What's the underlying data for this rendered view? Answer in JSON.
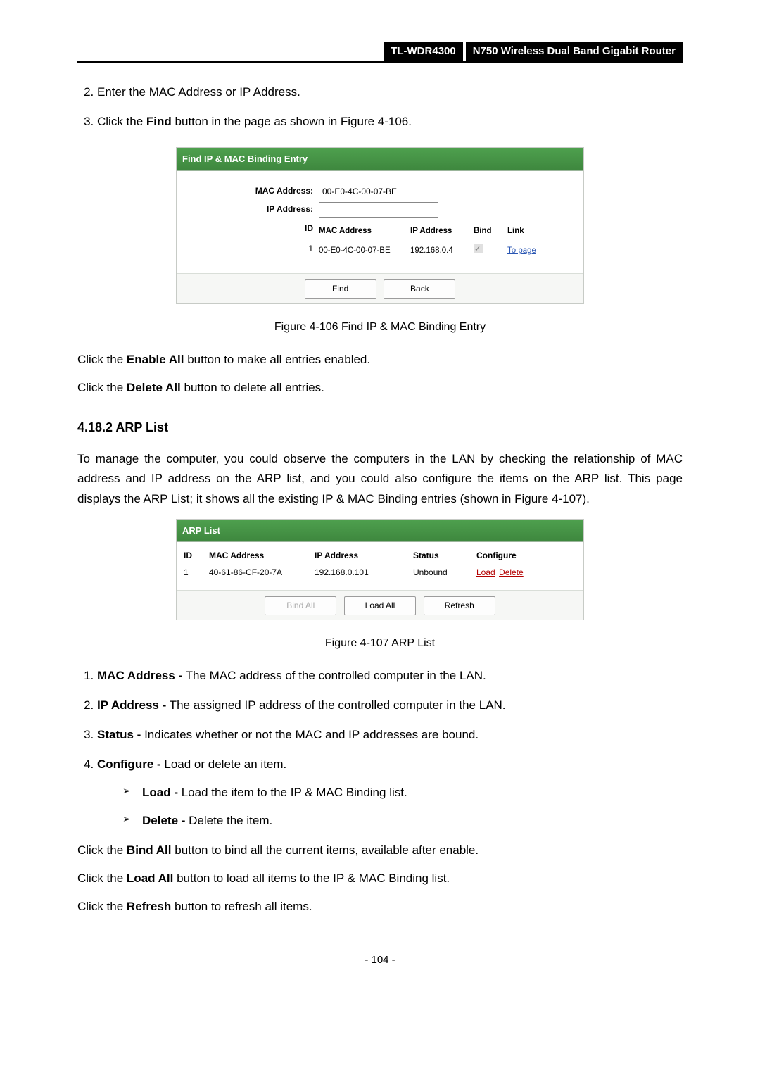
{
  "header": {
    "model": "TL-WDR4300",
    "product": "N750 Wireless Dual Band Gigabit Router"
  },
  "steps": {
    "s2_text": "Enter the MAC Address or IP Address.",
    "s3_prefix": "Click the ",
    "s3_bold": "Find",
    "s3_suffix": " button in the page as shown in Figure 4-106."
  },
  "fig106": {
    "title": "Find IP & MAC Binding Entry",
    "labels": {
      "mac": "MAC Address:",
      "ip": "IP Address:",
      "id": "ID"
    },
    "mac_value": "00-E0-4C-00-07-BE",
    "ip_value": "",
    "cols": {
      "mac": "MAC Address",
      "ip": "IP Address",
      "bind": "Bind",
      "link": "Link"
    },
    "row": {
      "id": "1",
      "mac": "00-E0-4C-00-07-BE",
      "ip": "192.168.0.4",
      "link": "To page"
    },
    "buttons": {
      "find": "Find",
      "back": "Back"
    },
    "caption": "Figure 4-106 Find IP & MAC Binding Entry"
  },
  "para1": {
    "p1a": "Click the ",
    "p1b": "Enable All",
    "p1c": " button to make all entries enabled."
  },
  "para2": {
    "p2a": "Click the ",
    "p2b": "Delete All",
    "p2c": " button to delete all entries."
  },
  "section": "4.18.2  ARP List",
  "arp_intro": "To manage the computer, you could observe the computers in the LAN by checking the relationship of MAC address and IP address on the ARP list, and you could also configure the items on the ARP list. This page displays the ARP List; it shows all the existing IP & MAC Binding entries (shown in Figure 4-107).",
  "fig107": {
    "title": "ARP List",
    "cols": {
      "id": "ID",
      "mac": "MAC Address",
      "ip": "IP Address",
      "status": "Status",
      "cfg": "Configure"
    },
    "row": {
      "id": "1",
      "mac": "40-61-86-CF-20-7A",
      "ip": "192.168.0.101",
      "status": "Unbound",
      "load": "Load",
      "delete": "Delete"
    },
    "buttons": {
      "bindall": "Bind All",
      "loadall": "Load All",
      "refresh": "Refresh"
    },
    "caption": "Figure 4-107 ARP List"
  },
  "defs": {
    "d1b": "MAC Address -",
    "d1t": " The MAC address of the controlled computer in the LAN.",
    "d2b": "IP Address -",
    "d2t": " The assigned IP address of the controlled computer in the LAN.",
    "d3b": "Status -",
    "d3t": " Indicates whether or not the MAC and IP addresses are bound.",
    "d4b": "Configure -",
    "d4t": " Load or delete an item.",
    "sub_load_b": "Load -",
    "sub_load_t": " Load the item to the IP & MAC Binding list.",
    "sub_del_b": "Delete -",
    "sub_del_t": " Delete the item."
  },
  "tail": {
    "t1a": "Click the ",
    "t1b": "Bind All",
    "t1c": " button to bind all the current items, available after enable.",
    "t2a": "Click the ",
    "t2b": "Load All",
    "t2c": " button to load all items to the IP & MAC Binding list.",
    "t3a": "Click the ",
    "t3b": "Refresh",
    "t3c": " button to refresh all items."
  },
  "pagenum": "- 104 -"
}
